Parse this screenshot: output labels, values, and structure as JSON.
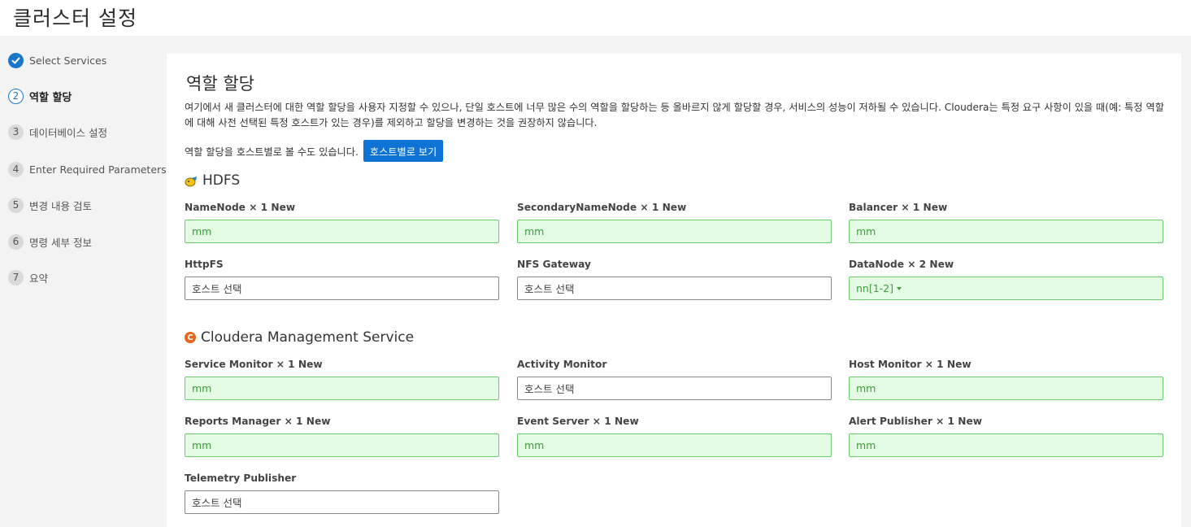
{
  "page": {
    "title": "클러스터 설정"
  },
  "steps": [
    {
      "num": "",
      "label": "Select Services",
      "state": "done"
    },
    {
      "num": "2",
      "label": "역할 할당",
      "state": "active"
    },
    {
      "num": "3",
      "label": "데이터베이스 설정",
      "state": "todo"
    },
    {
      "num": "4",
      "label": "Enter Required Parameters",
      "state": "todo"
    },
    {
      "num": "5",
      "label": "변경 내용 검토",
      "state": "todo"
    },
    {
      "num": "6",
      "label": "명령 세부 정보",
      "state": "todo"
    },
    {
      "num": "7",
      "label": "요약",
      "state": "todo"
    }
  ],
  "main": {
    "heading": "역할 할당",
    "description": "여기에서 새 클러스터에 대한 역할 할당을 사용자 지정할 수 있으나, 단일 호스트에 너무 많은 수의 역할을 할당하는 등 올바르지 않게 할당할 경우, 서비스의 성능이 저하될 수 있습니다. Cloudera는 특정 요구 사항이 있을 때(예: 특정 역할에 대해 사전 선택된 특정 호스트가 있는 경우)를 제외하고 할당을 변경하는 것을 권장하지 않습니다.",
    "host_view_text": "역할 할당을 호스트별로 볼 수도 있습니다.",
    "host_view_button": "호스트별로 보기"
  },
  "services": [
    {
      "name": "HDFS",
      "icon": "hdfs-icon",
      "roles": [
        {
          "label": "NameNode × 1 New",
          "value": "mm",
          "assigned": true
        },
        {
          "label": "SecondaryNameNode × 1 New",
          "value": "mm",
          "assigned": true
        },
        {
          "label": "Balancer × 1 New",
          "value": "mm",
          "assigned": true
        },
        {
          "label": "HttpFS",
          "value": "호스트 선택",
          "assigned": false
        },
        {
          "label": "NFS Gateway",
          "value": "호스트 선택",
          "assigned": false
        },
        {
          "label": "DataNode × 2 New",
          "value": "nn[1-2]",
          "assigned": true,
          "dropdown": true
        }
      ]
    },
    {
      "name": "Cloudera Management Service",
      "icon": "cloudera-manager-icon",
      "icon_glyph": "C",
      "roles": [
        {
          "label": "Service Monitor × 1 New",
          "value": "mm",
          "assigned": true
        },
        {
          "label": "Activity Monitor",
          "value": "호스트 선택",
          "assigned": false
        },
        {
          "label": "Host Monitor × 1 New",
          "value": "mm",
          "assigned": true
        },
        {
          "label": "Reports Manager × 1 New",
          "value": "mm",
          "assigned": true
        },
        {
          "label": "Event Server × 1 New",
          "value": "mm",
          "assigned": true
        },
        {
          "label": "Alert Publisher × 1 New",
          "value": "mm",
          "assigned": true
        },
        {
          "label": "Telemetry Publisher",
          "value": "호스트 선택",
          "assigned": false
        }
      ]
    }
  ],
  "colors": {
    "accent": "#1a76c9",
    "button": "#0f73d6",
    "assigned_bg": "#e4fbe4",
    "assigned_border": "#6ccb6c",
    "assigned_text": "#3a9d3a",
    "cloudera_orange": "#e8661e"
  }
}
